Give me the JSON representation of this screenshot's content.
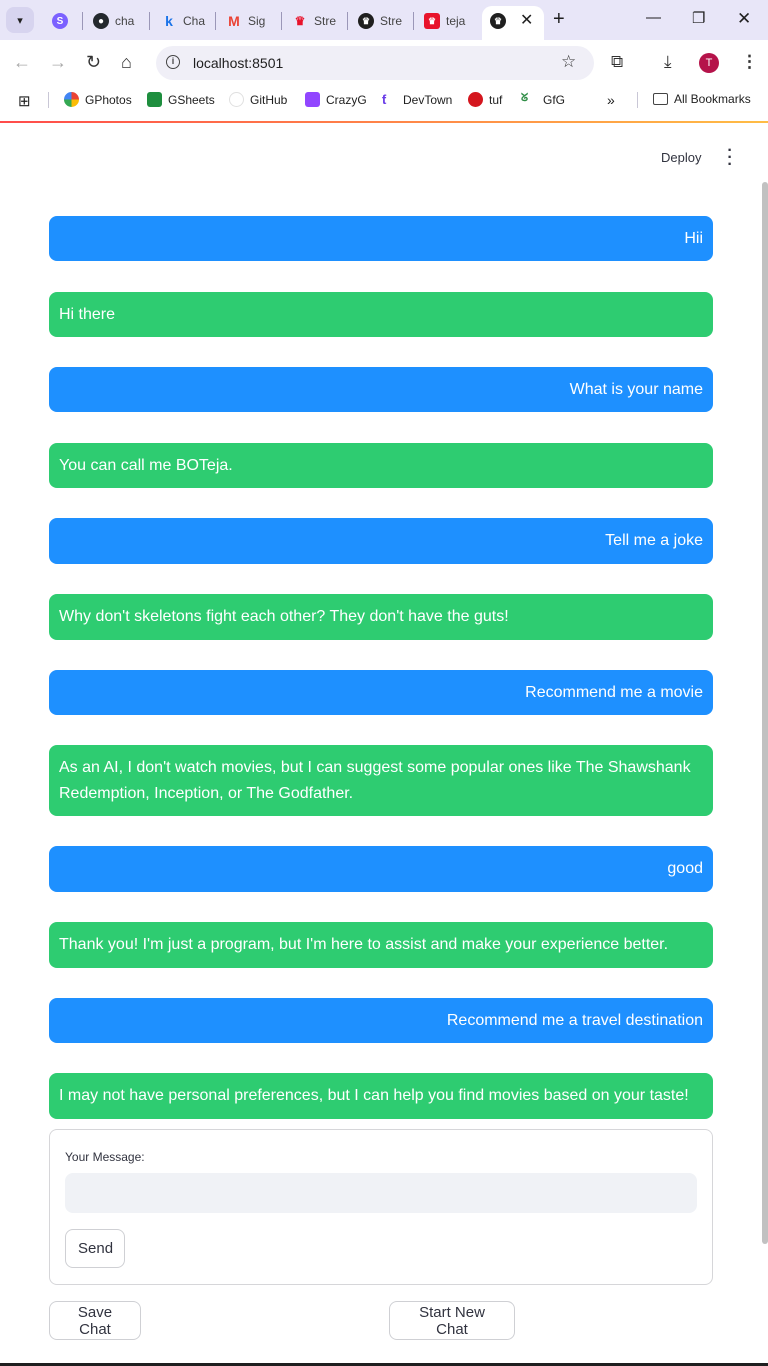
{
  "browser": {
    "tabs": [
      {
        "label": "",
        "icon": "streamlit-icon",
        "color": "#7b61ff"
      },
      {
        "label": "cha",
        "icon": "github-icon",
        "color": "#24292e"
      },
      {
        "label": "Cha",
        "icon": "k-icon",
        "color": "#1a73e8"
      },
      {
        "label": "Sig",
        "icon": "gmail-icon",
        "color": "#ea4335"
      },
      {
        "label": "Stre",
        "icon": "crown-icon",
        "color": "#e8132b"
      },
      {
        "label": "Stre",
        "icon": "streamlit-crown-icon",
        "color": "#1f1f1f"
      },
      {
        "label": "teja",
        "icon": "crown-icon",
        "color": "#e8132b"
      },
      {
        "label": "",
        "icon": "streamlit-crown-icon",
        "color": "#1f1f1f"
      }
    ],
    "url": "localhost:8501",
    "avatar_letter": "T",
    "bookmarks": [
      {
        "label": "GPhotos",
        "icon": "photos-icon"
      },
      {
        "label": "GSheets",
        "icon": "sheets-icon"
      },
      {
        "label": "GitHub",
        "icon": "github-icon"
      },
      {
        "label": "CrazyG",
        "icon": "twitch-icon"
      },
      {
        "label": "DevTown",
        "icon": "devtown-icon"
      },
      {
        "label": "tuf",
        "icon": "tuf-icon"
      },
      {
        "label": "GfG",
        "icon": "gfg-icon"
      }
    ],
    "all_bookmarks_label": "All Bookmarks",
    "more_bookmarks_glyph": "»"
  },
  "app": {
    "deploy_label": "Deploy",
    "messages": [
      {
        "role": "user",
        "text": "Hii"
      },
      {
        "role": "bot",
        "text": "Hi there"
      },
      {
        "role": "user",
        "text": "What is your name"
      },
      {
        "role": "bot",
        "text": "You can call me BOTeja."
      },
      {
        "role": "user",
        "text": "Tell me a joke"
      },
      {
        "role": "bot",
        "text": "Why don't skeletons fight each other? They don't have the guts!"
      },
      {
        "role": "user",
        "text": "Recommend me a movie"
      },
      {
        "role": "bot",
        "text": "As an AI, I don't watch movies, but I can suggest some popular ones like The Shawshank Redemption, Inception, or The Godfather."
      },
      {
        "role": "user",
        "text": "good"
      },
      {
        "role": "bot",
        "text": "Thank you! I'm just a program, but I'm here to assist and make your experience better."
      },
      {
        "role": "user",
        "text": "Recommend me a travel destination"
      },
      {
        "role": "bot",
        "text": "I may not have personal preferences, but I can help you find movies based on your taste!"
      }
    ],
    "form": {
      "label": "Your Message:",
      "value": "",
      "placeholder": "",
      "send_label": "Send"
    },
    "save_chat_label": "Save Chat",
    "new_chat_label": "Start New Chat",
    "colors": {
      "user_bubble": "#1e90ff",
      "bot_bubble": "#2ecc71"
    }
  }
}
